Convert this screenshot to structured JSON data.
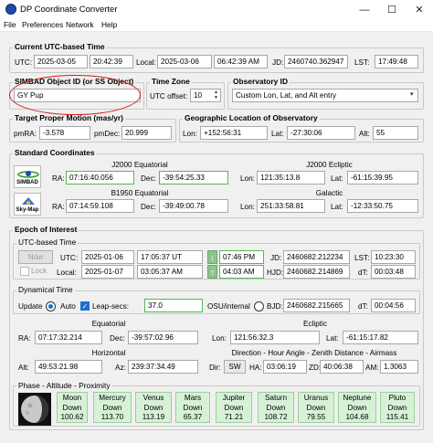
{
  "window": {
    "title": "DP Coordinate Converter",
    "minimize": "—",
    "maximize": "☐",
    "close": "✕"
  },
  "menu": [
    "File",
    "Preferences",
    "Network",
    "Help"
  ],
  "utc_time": {
    "title": "Current UTC-based Time",
    "utc_label": "UTC:",
    "date": "2025-03-05",
    "time": "20:42:39",
    "local_label": "Local:",
    "local_date": "2025-03-06",
    "local_time": "06:42:39 AM",
    "jd_label": "JD:",
    "jd": "2460740.362947",
    "lst_label": "LST:",
    "lst": "17:49:48"
  },
  "object": {
    "title": "SIMBAD Object ID (or SS Object)",
    "value": "GY Pup"
  },
  "timezone": {
    "title": "Time Zone",
    "label": "UTC offset:",
    "value": "10"
  },
  "observatory": {
    "title": "Observatory ID",
    "value": "Custom Lon, Lat, and Alt entry"
  },
  "motion": {
    "title": "Target Proper Motion (mas/yr)",
    "pmra_label": "pmRA:",
    "pmra": "-3.578",
    "pmdec_label": "pmDec:",
    "pmdec": "20.999"
  },
  "location": {
    "title": "Geographic Location of Observatory",
    "lon_label": "Lon:",
    "lon": "+152:56:31",
    "lat_label": "Lat:",
    "lat": "-27:30:06",
    "alt_label": "Alt:",
    "alt": "55"
  },
  "standard": {
    "title": "Standard Coordinates",
    "simbad_btn": "SIMBAD",
    "skymap_btn": "Sky-Map",
    "j2000_eq": {
      "title": "J2000 Equatorial",
      "ra_label": "RA:",
      "ra": "07:16:40.056",
      "dec_label": "Dec:",
      "dec": "-39:54:25.33"
    },
    "j2000_ec": {
      "title": "J2000 Ecliptic",
      "lon_label": "Lon:",
      "lon": "121:35:13.8",
      "lat_label": "Lat:",
      "lat": "-61:15:39.95"
    },
    "b1950_eq": {
      "title": "B1950 Equatorial",
      "ra_label": "RA:",
      "ra": "07:14:59.108",
      "dec_label": "Dec:",
      "dec": "-39:49:00.78"
    },
    "galactic": {
      "title": "Galactic",
      "lon_label": "Lon:",
      "lon": "251:33:58.81",
      "lat_label": "Lat:",
      "lat": "-12:33:50.75"
    }
  },
  "epoch": {
    "title": "Epoch of Interest",
    "utc": {
      "title": "UTC-based Time",
      "now_btn": "Now",
      "lock_label": "Lock",
      "utc_label": "UTC:",
      "date": "2025-01-06",
      "time": "17:05:37 UT",
      "sunset": "07:46 PM",
      "jd_label": "JD:",
      "jd": "2460682.212234",
      "lst_label": "LST:",
      "lst": "10:23:30",
      "local_label": "Local:",
      "local_date": "2025-01-07",
      "local_time": "03:05:37 AM",
      "sunrise": "04:03 AM",
      "hjd_label": "HJD:",
      "hjd": "2460682.214869",
      "dt_label": "dT:",
      "dt": "00:03:48"
    },
    "dynamical": {
      "title": "Dynamical Time",
      "update_label": "Update",
      "auto_label": "Auto",
      "leap_label": "Leap-secs:",
      "leap": "37.0",
      "osu_label": "OSU/internal",
      "bjd_label": "BJD:",
      "bjd": "2460682.215665",
      "dt_label": "dT:",
      "dt": "00:04:56"
    },
    "equatorial": {
      "title": "Equatorial",
      "ra_label": "RA:",
      "ra": "07:17:32.214",
      "dec_label": "Dec:",
      "dec": "-39:57:02.96"
    },
    "ecliptic": {
      "title": "Ecliptic",
      "lon_label": "Lon:",
      "lon": "121:56:32.3",
      "lat_label": "Lat:",
      "lat": "-61:15:17.82"
    },
    "horizontal": {
      "title": "Horizontal",
      "alt_label": "Alt:",
      "alt": "49:53:21.98",
      "az_label": "Az:",
      "az": "239:37:34.49"
    },
    "direction": {
      "title": "Direction - Hour Angle - Zenith Distance - Airmass",
      "dir_label": "Dir:",
      "dir": "SW",
      "ha_label": "HA:",
      "ha": "03:06:19",
      "zd_label": "ZD:",
      "zd": "40:06:38",
      "am_label": "AM:",
      "am": "1.3063"
    }
  },
  "proximity": {
    "title": "Phase - Altitude - Proximity",
    "planets": [
      {
        "name": "Moon",
        "state": "Down",
        "value": "100.62"
      },
      {
        "name": "Mercury",
        "state": "Down",
        "value": "113.70"
      },
      {
        "name": "Venus",
        "state": "Down",
        "value": "113.19"
      },
      {
        "name": "Mars",
        "state": "Down",
        "value": "65.37"
      },
      {
        "name": "Jupiter",
        "state": "Down",
        "value": "71.21"
      },
      {
        "name": "Saturn",
        "state": "Down",
        "value": "108.72"
      },
      {
        "name": "Uranus",
        "state": "Down",
        "value": "79.55"
      },
      {
        "name": "Neptune",
        "state": "Down",
        "value": "104.68"
      },
      {
        "name": "Pluto",
        "state": "Down",
        "value": "115.41"
      }
    ]
  },
  "colors": {
    "accent_green": "#d7f1d7",
    "annotation_red": "#d81c1c"
  }
}
